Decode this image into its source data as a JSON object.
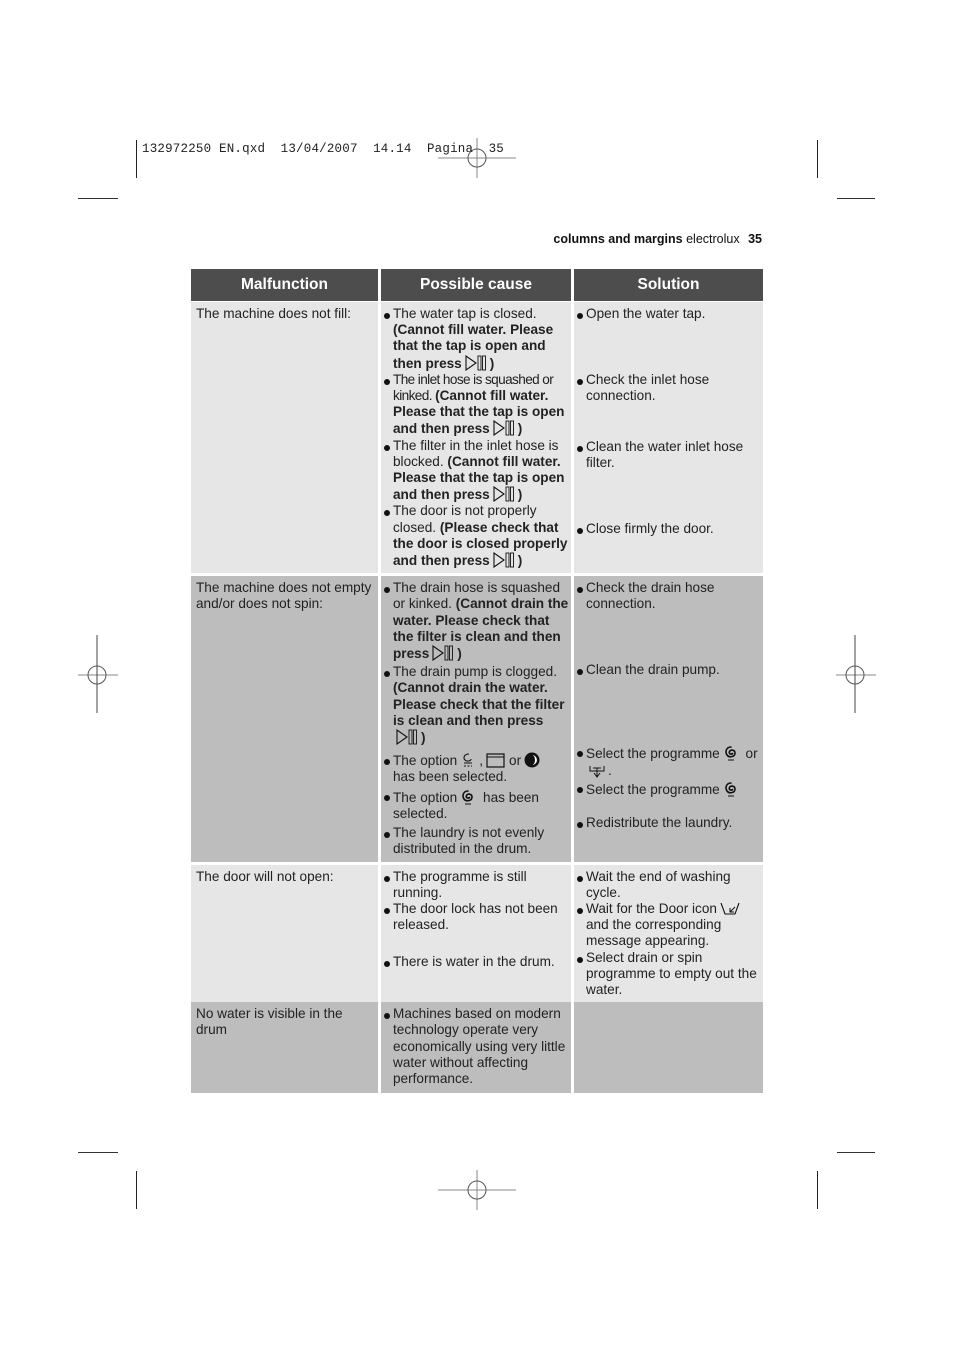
{
  "slug": {
    "file": "132972250 EN.qxd",
    "date": "13/04/2007",
    "time": "14.14",
    "page_label": "Pagina",
    "page_number": "35"
  },
  "running_head": {
    "section": "columns and margins",
    "brand": "electrolux",
    "page": "35"
  },
  "table": {
    "headers": [
      "Malfunction",
      "Possible cause",
      "Solution"
    ],
    "rows": [
      {
        "malfunction": "The machine does not fill:",
        "causes": [
          {
            "text": "The water tap is closed.",
            "bold": "(Cannot fill water. Please that the tap is open and then press",
            "icon": "start-pause-icon",
            "end": ")"
          },
          {
            "text": "The inlet hose is squashed or kinked.",
            "bold": "(Cannot fill water. Please that the tap is open and then press",
            "icon": "start-pause-icon",
            "end": ")"
          },
          {
            "text": "The filter in the inlet hose is blocked.",
            "bold": "(Cannot fill water. Please that the tap is open and then press",
            "icon": "start-pause-icon",
            "end": ")"
          },
          {
            "text": "The door is not properly closed.",
            "bold": "(Please check that the door is closed properly and then press",
            "icon": "start-pause-icon",
            "end": ")"
          }
        ],
        "solutions": [
          {
            "text": "Open the water tap."
          },
          {
            "text": "Check the inlet hose connection."
          },
          {
            "text": "Clean the water inlet hose filter."
          },
          {
            "text": "Close firmly the door."
          }
        ]
      },
      {
        "malfunction": "The machine does not empty and/or does not spin:",
        "causes": [
          {
            "text": "The drain hose is squashed or kinked.",
            "bold": "(Cannot drain the water. Please check that the filter is clean and then press",
            "icon": "start-pause-icon",
            "end": ")"
          },
          {
            "text": "The drain pump is clogged.",
            "bold": "(Cannot drain the water. Please check that the filter is clean and then press",
            "icon": "start-pause-icon",
            "end": ")"
          },
          {
            "text_a": "The option",
            "sep1": ",",
            "sep2": "or",
            "text_b": "has been selected.",
            "icons": [
              "rinse-hold-icon",
              "no-spin-icon",
              "night-cycle-icon"
            ]
          },
          {
            "text_a": "The option",
            "text_b": "has been selected.",
            "icons": [
              "spin-icon"
            ]
          },
          {
            "text": "The laundry is not evenly distributed in the drum."
          }
        ],
        "solutions": [
          {
            "text": "Check the drain hose connection."
          },
          {
            "text": "Clean the drain pump."
          },
          {
            "text_a": "Select the programme",
            "sep": "or",
            "end": ".",
            "icons": [
              "spin-icon",
              "drain-icon"
            ]
          },
          {
            "text_a": "Select the programme",
            "icons": [
              "spin-icon"
            ]
          },
          {
            "text": "Redistribute the laundry."
          }
        ]
      },
      {
        "malfunction": "The door will not open:",
        "causes": [
          {
            "text": "The programme is still running."
          },
          {
            "text": "The door lock has not been released."
          },
          {
            "text": "There is water in the drum."
          }
        ],
        "solutions": [
          {
            "text": "Wait the end of washing cycle."
          },
          {
            "text_a": "Wait for the Door icon",
            "text_b": "and the corresponding message appearing.",
            "icons": [
              "door-icon"
            ]
          },
          {
            "text": "Select drain or spin programme to empty out the water."
          }
        ]
      },
      {
        "malfunction": "No water is visible in the drum",
        "causes": [
          {
            "text": "Machines based on modern technology operate very economically using very little water without affecting performance."
          }
        ],
        "solutions": []
      }
    ]
  },
  "colors": {
    "header_bg": "#4d4d4d",
    "row_light": "#e6e6e6",
    "row_dark": "#bdbdbd"
  }
}
